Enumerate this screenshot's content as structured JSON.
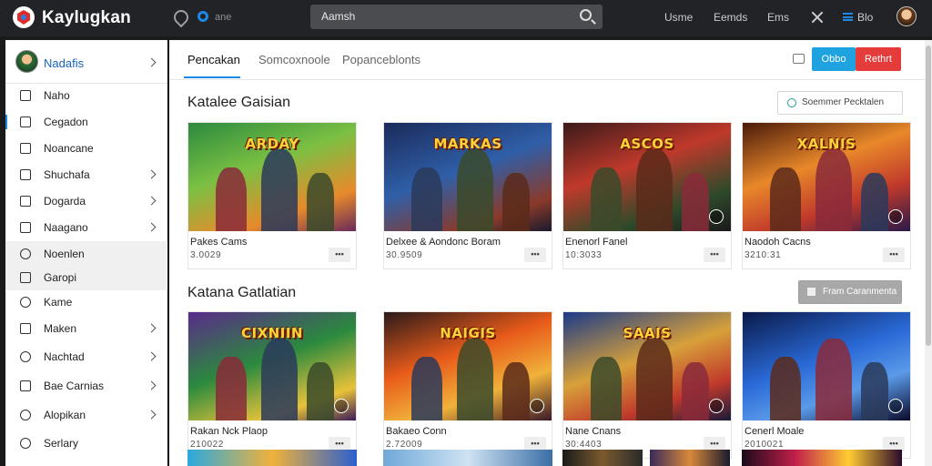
{
  "header": {
    "brand": "Kaylugkan",
    "small_label": "ane",
    "search_value": "Aamsh",
    "nav_links": [
      "Usme",
      "Eemds",
      "Ems"
    ],
    "menu_label": "Blo"
  },
  "sidebar": {
    "profile_name": "Nadafis",
    "items": [
      {
        "label": "Naho",
        "chevron": false
      },
      {
        "label": "Cegadon",
        "chevron": false
      },
      {
        "label": "Noancane",
        "chevron": false
      },
      {
        "label": "Shuchafa",
        "chevron": true
      },
      {
        "label": "Dogarda",
        "chevron": true
      },
      {
        "label": "Naagano",
        "chevron": true
      },
      {
        "label": "Noenlen",
        "chevron": false
      },
      {
        "label": "Garopi",
        "chevron": false
      },
      {
        "label": "Kame",
        "chevron": false
      },
      {
        "label": "Maken",
        "chevron": true
      },
      {
        "label": "Nachtad",
        "chevron": true
      },
      {
        "label": "Bae Carnias",
        "chevron": true
      },
      {
        "label": "Alopikan",
        "chevron": true
      },
      {
        "label": "Serlary",
        "chevron": false
      }
    ]
  },
  "tabs": [
    "Pencakan",
    "Somcoxnoole",
    "Popanceblonts"
  ],
  "buttons": {
    "primary": "Obbo",
    "danger": "Rethrt"
  },
  "sections": [
    {
      "title": "Katalee Gaisian",
      "button": "Soemmer Pecktalen",
      "cards": [
        {
          "title": "ARDAY",
          "name": "Pakes Cams",
          "meta": "3.0029"
        },
        {
          "title": "MARKAS",
          "name": "Delxee & Aondonc Boram",
          "meta": "30.9509"
        },
        {
          "title": "ASCOS",
          "name": "Enenorl Fanel",
          "meta": "10:3033"
        },
        {
          "title": "XALNIS",
          "name": "Naodoh Cacns",
          "meta": "3210:31"
        }
      ]
    },
    {
      "title": "Katana Gatlatian",
      "button": "Fram Caranmenta",
      "cards": [
        {
          "title": "CIXNIIN",
          "name": "Rakan Nck Plaop",
          "meta": "210022"
        },
        {
          "title": "NAIGIS",
          "name": "Bakaeo Conn",
          "meta": "2.72009"
        },
        {
          "title": "SAAIS",
          "name": "Nane Cnans",
          "meta": "30:4403"
        },
        {
          "title": "",
          "name": "Cenerl Moale",
          "meta": "2010021"
        }
      ]
    }
  ],
  "more_label": "•••"
}
